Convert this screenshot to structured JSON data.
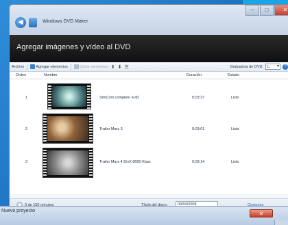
{
  "window": {
    "title": "Windows DVD Maker",
    "close_glyph": "✕",
    "min_glyph": "–",
    "max_glyph": "□"
  },
  "header": {
    "title": "Agregar imágenes y vídeo al DVD"
  },
  "toolbar": {
    "file_label": "Archivo",
    "add_items_label": "Agregar elementos",
    "remove_items_label": "Quitar elementos",
    "burner_label": "Grabadora de DVD:",
    "burner_value": "L:"
  },
  "table": {
    "columns": [
      "Orden",
      "Nombre",
      "Duración",
      "Estado"
    ],
    "rows": [
      {
        "order": "1",
        "name": "SimCom completo XviD",
        "duration": "0:03:27",
        "status": "Listo"
      },
      {
        "order": "2",
        "name": "Trailer Mars 3",
        "duration": "0:03:01",
        "status": "Listo"
      },
      {
        "order": "3",
        "name": "Trailer Mars 4 DivX 8000 Kbps",
        "duration": "0:03:14",
        "status": "Listo"
      }
    ]
  },
  "status": {
    "minutes_text": "9 de 150 minutos",
    "disc_title_label": "Título del disco:",
    "disc_title_value": "04/04/2008",
    "options_label": "Opciones"
  },
  "dialog": {
    "title": "Nuevo proyecto",
    "close_glyph": "✕"
  }
}
